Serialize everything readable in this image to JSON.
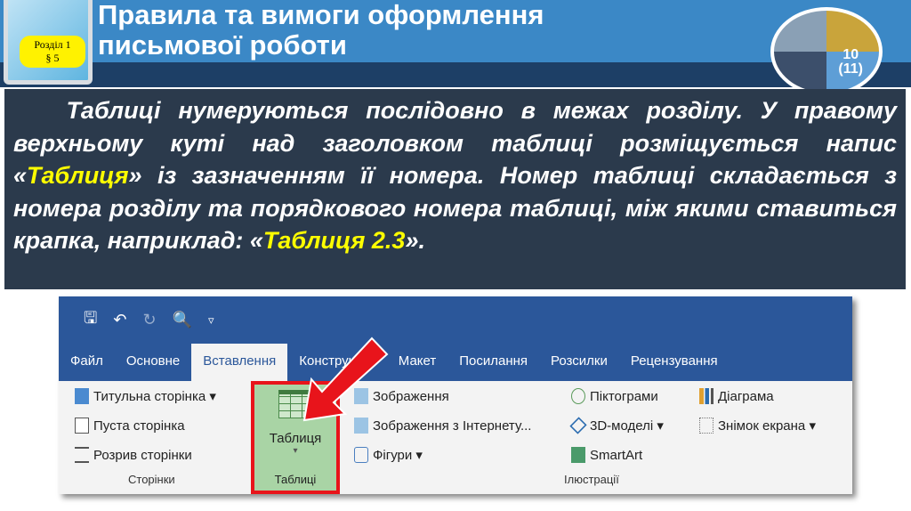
{
  "header": {
    "title_line1": "Правила та вимоги оформлення",
    "title_line2": "письмової роботи",
    "badge_line1": "Розділ 1",
    "badge_line2": "§ 5",
    "grade_line1": "10",
    "grade_line2": "(11)"
  },
  "text": {
    "p1": "Таблиці нумеруються послідовно в межах розділу. У правому верхньому куті над заголовком таблиці розміщується напис «",
    "hl1": "Таблиця",
    "p2": "» із зазначенням її номера. Номер таблиці складається з номера розділу та порядкового номера таблиці, між якими ставиться крапка, наприклад: «",
    "hl2": "Таблиця 2.3",
    "p3": "»."
  },
  "word": {
    "qat": {
      "save": "🖫",
      "undo": "↶",
      "redo": "↻",
      "preview": "🔍",
      "more": "▿"
    },
    "tabs": [
      "Файл",
      "Основне",
      "Вставлення",
      "Конструктор",
      "Макет",
      "Посилання",
      "Розсилки",
      "Рецензування"
    ],
    "pages": {
      "cover": "Титульна сторінка ▾",
      "blank": "Пуста сторінка",
      "break": "Розрив сторінки",
      "group": "Сторінки"
    },
    "tables": {
      "button": "Таблиця",
      "dropdown": "▾",
      "group": "Таблиці"
    },
    "illustrations": {
      "pictures": "Зображення",
      "online": "Зображення з Інтернету...",
      "shapes": "Фігури ▾",
      "icons": "Піктограми",
      "models": "3D-моделі  ▾",
      "smartart": "SmartArt",
      "chart": "Діаграма",
      "screenshot": "Знімок екрана ▾",
      "group": "Ілюстрації"
    }
  },
  "colors": {
    "ribbon_blue": "#2b579a",
    "highlight": "#ffff00",
    "table_button": "#a9d4a5",
    "arrow": "#e8141b"
  }
}
